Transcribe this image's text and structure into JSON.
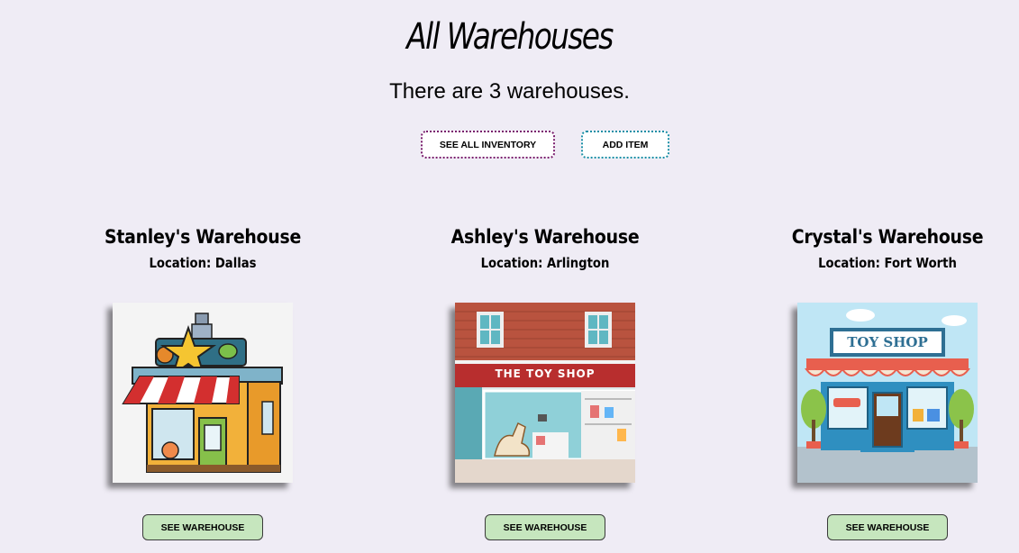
{
  "header": {
    "title": "All Warehouses",
    "count_text": "There are 3 warehouses."
  },
  "actions": {
    "see_all_inventory": "SEE ALL INVENTORY",
    "add_item": "ADD ITEM"
  },
  "warehouses": [
    {
      "name": "Stanley's Warehouse",
      "location": "Location: Dallas",
      "image": "cartoon-toy-store-illustration",
      "button": "SEE WAREHOUSE"
    },
    {
      "name": "Ashley's Warehouse",
      "location": "Location: Arlington",
      "image": "the-toy-shop-storefront-illustration",
      "image_text": "THE TOY SHOP",
      "button": "SEE WAREHOUSE"
    },
    {
      "name": "Crystal's Warehouse",
      "location": "Location: Fort Worth",
      "image": "toy-shop-storefront-illustration",
      "image_text": "TOY SHOP",
      "button": "SEE WAREHOUSE"
    }
  ],
  "colors": {
    "background": "#efecf5",
    "inventory_border": "#7a1f6e",
    "add_border": "#1c8fa6",
    "see_button_bg": "#c6e6be"
  }
}
